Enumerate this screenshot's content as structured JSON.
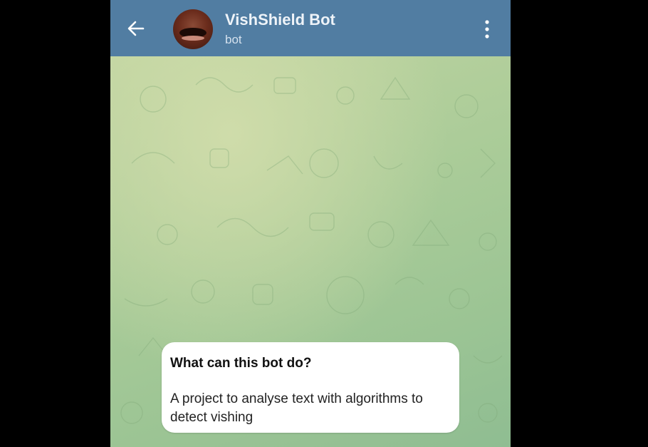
{
  "header": {
    "title": "VishShield Bot",
    "subtitle": "bot",
    "back_icon": "arrow-left-icon",
    "menu_icon": "more-vertical-icon"
  },
  "chat": {
    "intro": {
      "title": "What can this bot do?",
      "body": "A project to analyse text with algorithms to detect vishing"
    }
  },
  "colors": {
    "header_bg": "#517da2",
    "chat_bg": "#a9cb98",
    "bubble_bg": "#ffffff",
    "letterbox": "#000000"
  }
}
